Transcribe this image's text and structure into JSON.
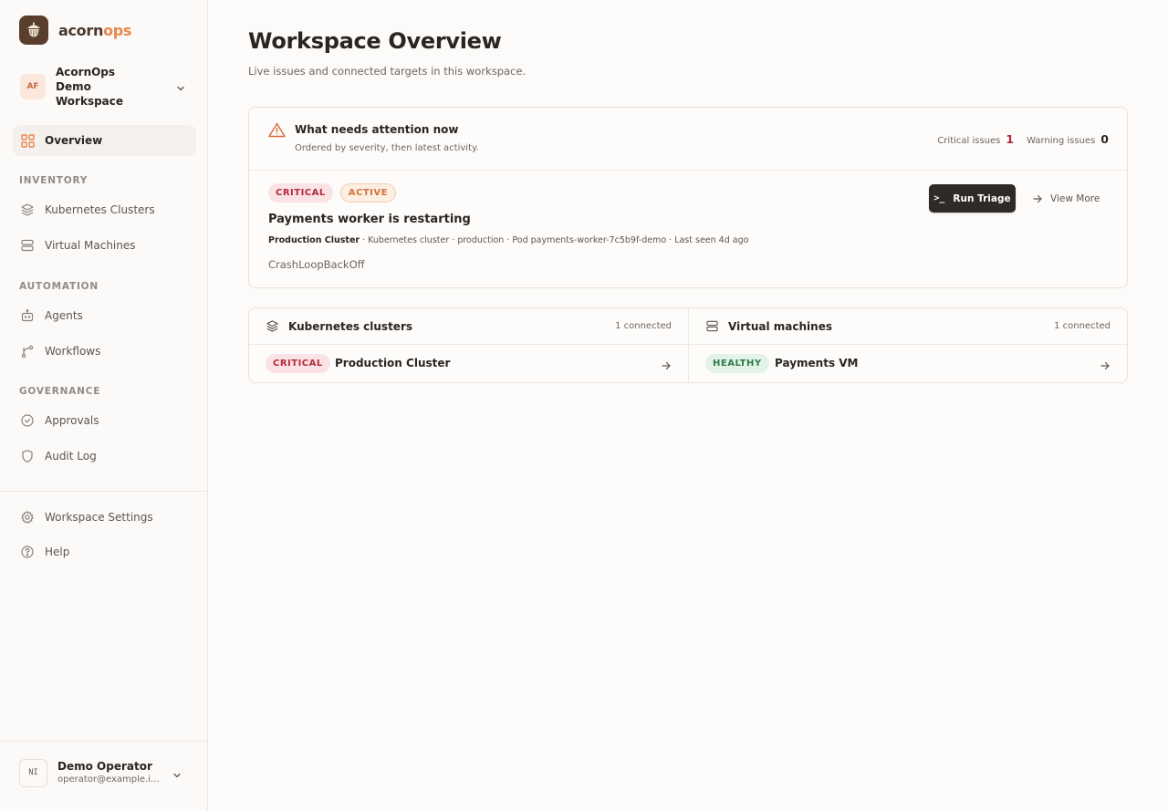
{
  "brand": {
    "name_part1": "acorn",
    "name_part2": "ops"
  },
  "workspace": {
    "initials": "AF",
    "name": "AcornOps Demo Workspace"
  },
  "nav": {
    "overview": "Overview",
    "inventory_title": "INVENTORY",
    "kubernetes_clusters": "Kubernetes Clusters",
    "virtual_machines": "Virtual Machines",
    "automation_title": "AUTOMATION",
    "agents": "Agents",
    "workflows": "Workflows",
    "governance_title": "GOVERNANCE",
    "approvals": "Approvals",
    "audit_log": "Audit Log",
    "workspace_settings": "Workspace Settings",
    "help": "Help"
  },
  "user": {
    "initials": "NI",
    "name": "Demo Operator",
    "email": "operator@example.i..."
  },
  "page": {
    "title": "Workspace Overview",
    "subtitle": "Live issues and connected targets in this workspace."
  },
  "attention": {
    "title": "What needs attention now",
    "subtitle": "Ordered by severity, then latest activity.",
    "critical_label": "Critical issues",
    "critical_count": "1",
    "warning_label": "Warning issues",
    "warning_count": "0"
  },
  "issue": {
    "severity": "CRITICAL",
    "status": "ACTIVE",
    "title": "Payments worker is restarting",
    "target": "Production Cluster",
    "meta": " · Kubernetes cluster · production · Pod payments-worker-7c5b9f-demo · Last seen 4d ago",
    "reason": "CrashLoopBackOff",
    "run_triage": "Run Triage",
    "view_more": "View More"
  },
  "targets": {
    "kubernetes": {
      "title": "Kubernetes clusters",
      "count": "1 connected",
      "item": {
        "status": "CRITICAL",
        "name": "Production Cluster"
      }
    },
    "vms": {
      "title": "Virtual machines",
      "count": "1 connected",
      "item": {
        "status": "HEALTHY",
        "name": "Payments VM"
      }
    }
  },
  "colors": {
    "accent": "#e8864b",
    "critical": "#b32a3b",
    "healthy": "#2d7a4a",
    "dark_button": "#2e2a27"
  }
}
